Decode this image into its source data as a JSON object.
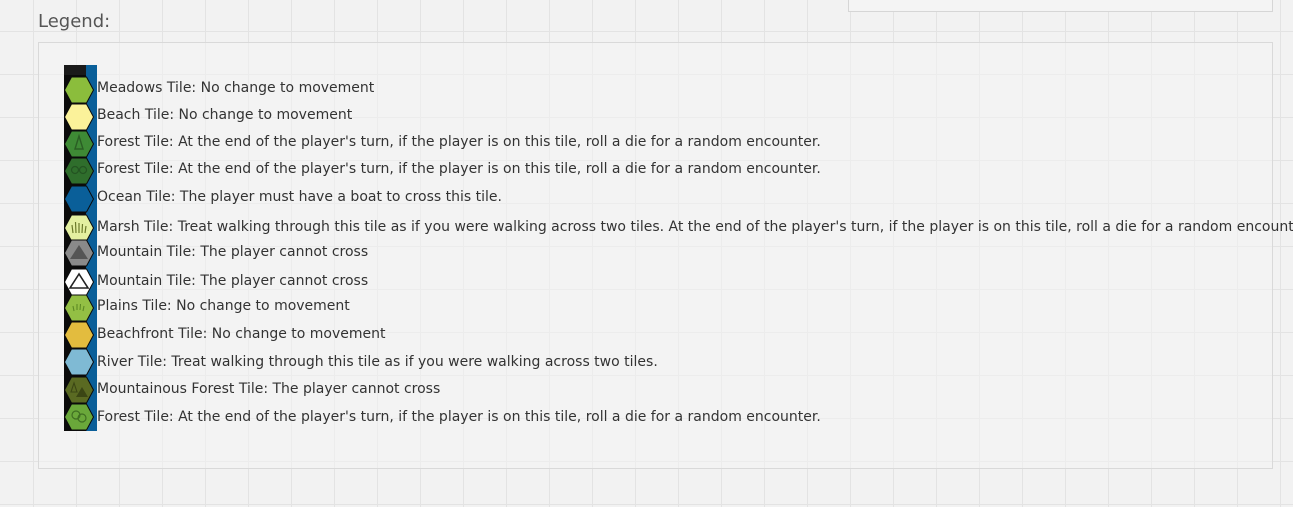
{
  "legend": {
    "title": "Legend:",
    "items": [
      {
        "icon": "meadows-hex-icon",
        "color": "#8bbd3c",
        "label": "Meadows Tile: No change to movement"
      },
      {
        "icon": "beach-hex-icon",
        "color": "#fbf29a",
        "label": "Beach Tile: No change to movement"
      },
      {
        "icon": "forest-hex-icon",
        "color": "#3e8a35",
        "label": "Forest Tile: At the end of the player's turn, if the player is on this tile, roll a die for a random encounter."
      },
      {
        "icon": "forest-dense-hex-icon",
        "color": "#2f6e2c",
        "label": "Forest Tile: At the end of the player's turn, if the player is on this tile, roll a die for a random encounter."
      },
      {
        "icon": "ocean-hex-icon",
        "color": "#0a5f99",
        "label": "Ocean Tile: The player must have a boat to cross this tile."
      },
      {
        "icon": "marsh-hex-icon",
        "color": "#e3f0a0",
        "label": "Marsh Tile: Treat walking through this tile as if you were walking across two tiles.  At the end of the player's turn, if the player is on this tile, roll a die for a random encounter."
      },
      {
        "icon": "mountain-grey-hex-icon",
        "color": "#8a8a8a",
        "label": "Mountain Tile: The player cannot cross"
      },
      {
        "icon": "mountain-snow-hex-icon",
        "color": "#ffffff",
        "label": "Mountain Tile: The player cannot cross"
      },
      {
        "icon": "plains-hex-icon",
        "color": "#93bf44",
        "label": "Plains Tile: No change to movement"
      },
      {
        "icon": "beachfront-hex-icon",
        "color": "#e3bc3e",
        "label": "Beachfront Tile: No change to movement"
      },
      {
        "icon": "river-hex-icon",
        "color": "#7fbad4",
        "label": "River Tile: Treat walking through this tile as if you were walking across two tiles."
      },
      {
        "icon": "mountainous-forest-hex-icon",
        "color": "#5a6a22",
        "label": "Mountainous Forest Tile: The player cannot cross"
      },
      {
        "icon": "forest-deciduous-hex-icon",
        "color": "#6aa83a",
        "label": "Forest Tile: At the end of the player's turn, if the player is on this tile, roll a die for a random encounter."
      }
    ]
  }
}
